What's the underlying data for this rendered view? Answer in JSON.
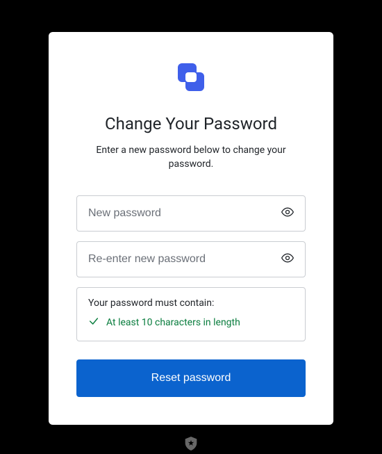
{
  "header": {
    "title": "Change Your Password",
    "subtitle": "Enter a new password below to change your password."
  },
  "fields": {
    "new_password": {
      "placeholder": "New password",
      "value": ""
    },
    "confirm_password": {
      "placeholder": "Re-enter new password",
      "value": ""
    }
  },
  "rules": {
    "heading": "Your password must contain:",
    "items": [
      {
        "text": "At least 10 characters in length",
        "met": true
      }
    ]
  },
  "actions": {
    "submit_label": "Reset password"
  },
  "colors": {
    "accent": "#0b63ce",
    "success": "#0a7d3e",
    "logo": "#3f5fea"
  }
}
